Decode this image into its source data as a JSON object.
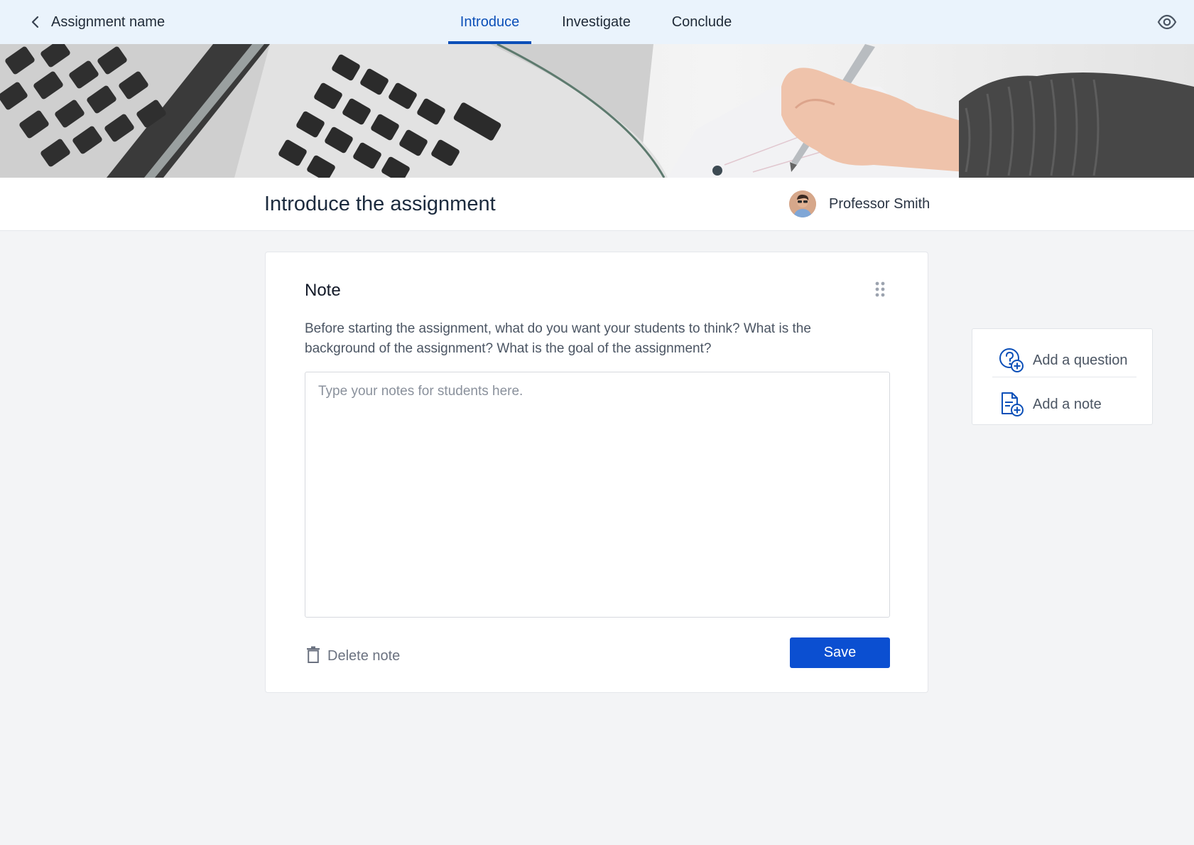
{
  "nav": {
    "back_label": "Assignment name",
    "tabs": [
      {
        "label": "Introduce",
        "active": true
      },
      {
        "label": "Investigate",
        "active": false
      },
      {
        "label": "Conclude",
        "active": false
      }
    ],
    "preview_icon": "eye-icon"
  },
  "banner": {
    "image": "laptop-and-writing-hand-photo"
  },
  "header": {
    "title": "Introduce the assignment",
    "author": "Professor Smith"
  },
  "note_card": {
    "title": "Note",
    "description": "Before starting the assignment, what do you want your students to think? What is the background of the assignment? What is the goal of the assignment?",
    "placeholder": "Type your notes for students here.",
    "value": "",
    "delete_label": "Delete note",
    "save_label": "Save"
  },
  "side_panel": {
    "items": [
      {
        "label": "Add a question",
        "icon": "question-add-icon"
      },
      {
        "label": "Add a note",
        "icon": "note-add-icon"
      }
    ]
  },
  "colors": {
    "accent": "#0b4fd1",
    "nav_bg": "#eaf3fc",
    "page_bg": "#f3f4f6"
  }
}
